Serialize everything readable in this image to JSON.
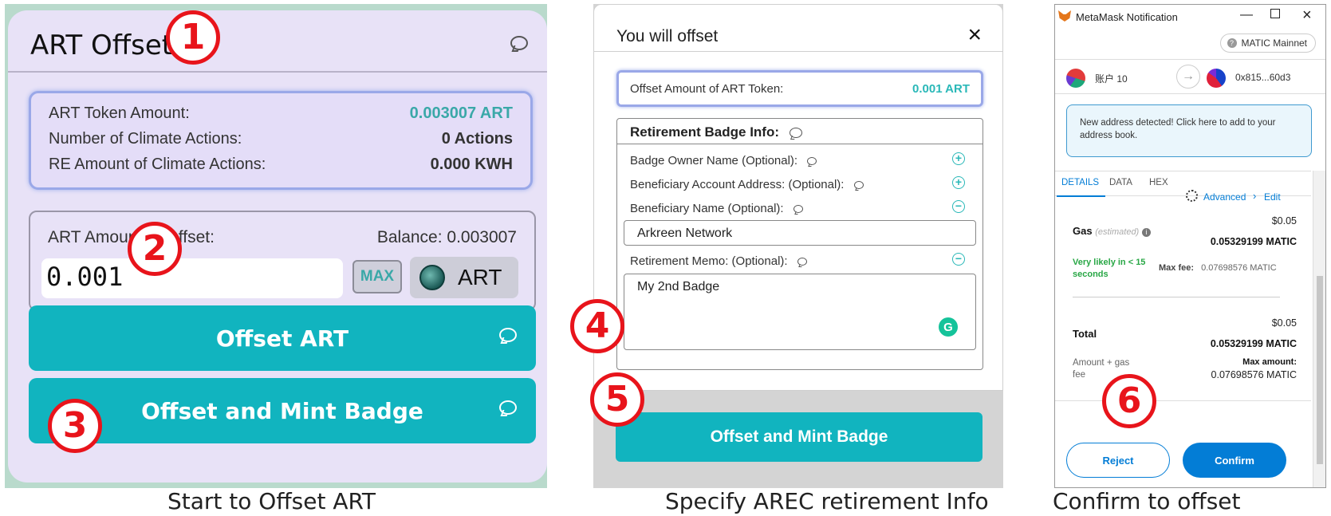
{
  "panel1": {
    "title": "ART Offset",
    "info": {
      "token_amount_label": "ART Token Amount:",
      "token_amount_value": "0.003007 ART",
      "climate_actions_label": "Number of Climate Actions:",
      "climate_actions_value": "0 Actions",
      "re_amount_label": "RE Amount of Climate Actions:",
      "re_amount_value": "0.000 KWH"
    },
    "amount_label": "ART Amount to Offset:",
    "balance_label": "Balance: 0.003007",
    "amount_value": "0.001",
    "max_label": "MAX",
    "token_label": "ART",
    "offset_button": "Offset ART",
    "offset_mint_button": "Offset and Mint Badge",
    "caption": "Start to Offset ART"
  },
  "panel2": {
    "title": "You will offset",
    "close": "×",
    "offset_amount_label": "Offset Amount of ART Token:",
    "offset_amount_value": "0.001 ART",
    "badge_header": "Retirement Badge Info:",
    "badge_owner_label": "Badge Owner Name (Optional):",
    "beneficiary_address_label": "Beneficiary Account Address: (Optional):",
    "beneficiary_name_label": "Beneficiary Name (Optional):",
    "beneficiary_name_value": "Arkreen Network",
    "memo_label": "Retirement Memo: (Optional):",
    "memo_value": "My 2nd Badge",
    "plus": "+",
    "minus": "−",
    "grammarly": "G",
    "button": "Offset and Mint Badge",
    "caption": "Specify AREC retirement Info"
  },
  "panel3": {
    "window_title": "MetaMask Notification",
    "network": "MATIC Mainnet",
    "from_account": "账户 10",
    "to_account": "0x815...60d3",
    "arrow": "→",
    "notice": "New address detected! Click here to add to your address book.",
    "tabs": [
      "DETAILS",
      "DATA",
      "HEX"
    ],
    "advanced": "Advanced",
    "edit": "Edit",
    "gas_label": "Gas",
    "gas_estimated": "(estimated)",
    "gas_usd": "$0.05",
    "gas_matic": "0.05329199 MATIC",
    "likely": "Very likely in < 15 seconds",
    "max_fee_label": "Max fee:",
    "max_fee_value": "0.07698576 MATIC",
    "total_label": "Total",
    "total_usd": "$0.05",
    "total_matic": "0.05329199 MATIC",
    "amount_gas_label": "Amount + gas fee",
    "max_amount_label": "Max amount:",
    "max_amount_value": "0.07698576 MATIC",
    "reject": "Reject",
    "confirm": "Confirm",
    "caption": "Confirm to offset"
  },
  "steps": [
    "1",
    "2",
    "3",
    "4",
    "5",
    "6"
  ],
  "colors": {
    "teal": "#11b4bf",
    "metamask_blue": "#037dd6",
    "step_red": "#e8141b",
    "panel_lilac": "#e8e2f7"
  }
}
